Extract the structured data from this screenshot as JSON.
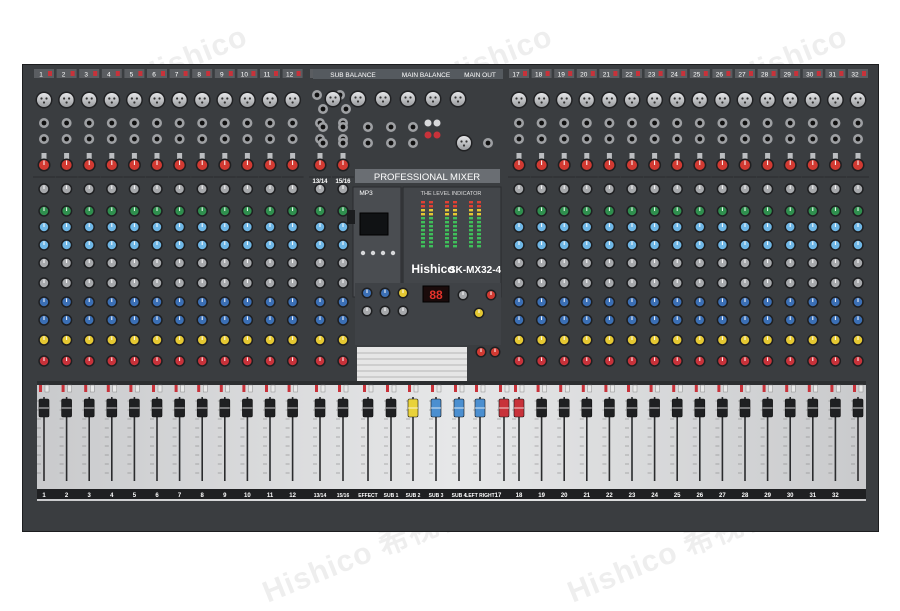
{
  "image": {
    "background": "#ffffff",
    "object": "audio mixing console"
  },
  "mixer": {
    "brand": "Hishico",
    "model": "SK-MX32-4",
    "panel_title": "PROFESSIONAL MIXER",
    "level_indicator_label": "THE LEVEL INDICATOR",
    "mp3_label": "MP3",
    "display_digits": "88",
    "section_labels": {
      "sub_balance": "SUB BALANCE",
      "main_balance": "MAIN BALANCE",
      "main_out": "MAIN OUT"
    },
    "stereo_channel_labels": [
      "13/14",
      "15/16"
    ],
    "channel_labels_left": [
      "1",
      "2",
      "3",
      "4",
      "5",
      "6",
      "7",
      "8",
      "9",
      "10",
      "11",
      "12"
    ],
    "channel_labels_right": [
      "17",
      "18",
      "19",
      "20",
      "21",
      "22",
      "23",
      "24",
      "25",
      "26",
      "27",
      "28",
      "29",
      "30",
      "31",
      "32"
    ],
    "fader_labels": [
      "1",
      "2",
      "3",
      "4",
      "5",
      "6",
      "7",
      "8",
      "9",
      "10",
      "11",
      "12",
      "13/14",
      "15/16",
      "EFFECT",
      "SUB 1",
      "SUB 2",
      "SUB 3",
      "SUB 4",
      "LEFT RIGHT",
      "17",
      "18",
      "19",
      "20",
      "21",
      "22",
      "23",
      "24",
      "25",
      "26",
      "27",
      "28",
      "29",
      "30",
      "31",
      "32"
    ],
    "colors": {
      "panel": "#3a3d40",
      "fader_tray": "#d8d9db",
      "gain_knob": "#d23a32",
      "eq_high": "#2f8f4e",
      "eq_mid": "#6fb7e6",
      "aux": "#3b6fb5",
      "pan": "#e5c832",
      "group_fader_yellow": "#e9d23a",
      "group_fader_blue": "#4b8fd0",
      "group_fader_red": "#c8323a"
    }
  },
  "watermarks": [
    "Hishico",
    "Hishico",
    "Hishico",
    "Hishico",
    "Hishico",
    "Hishico 希视科",
    "Hishico 希视科"
  ]
}
